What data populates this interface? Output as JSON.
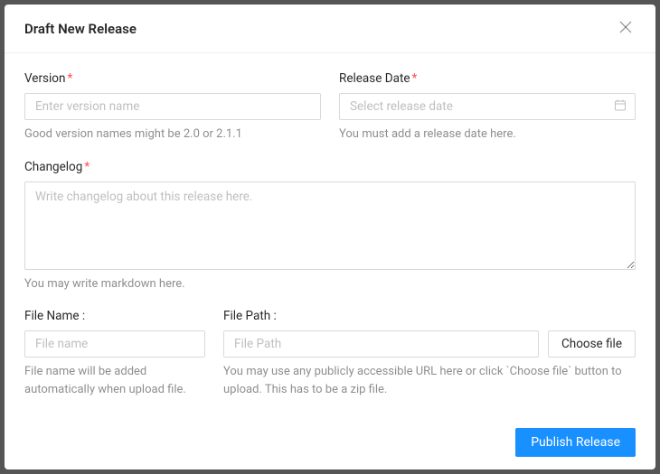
{
  "modal": {
    "title": "Draft New Release",
    "close": "✕"
  },
  "version": {
    "label": "Version",
    "placeholder": "Enter version name",
    "hint": "Good version names might be 2.0 or 2.1.1"
  },
  "release_date": {
    "label": "Release Date",
    "placeholder": "Select release date",
    "hint": "You must add a release date here."
  },
  "changelog": {
    "label": "Changelog",
    "placeholder": "Write changelog about this release here.",
    "hint": "You may write markdown here."
  },
  "file_name": {
    "label": "File Name :",
    "placeholder": "File name",
    "hint": "File name will be added automatically when upload file."
  },
  "file_path": {
    "label": "File Path :",
    "placeholder": "File Path",
    "hint": "You may use any publicly accessible URL here or click `Choose file` button to upload. This has to be a zip file."
  },
  "buttons": {
    "choose_file": "Choose file",
    "publish": "Publish Release"
  },
  "required_mark": "*"
}
